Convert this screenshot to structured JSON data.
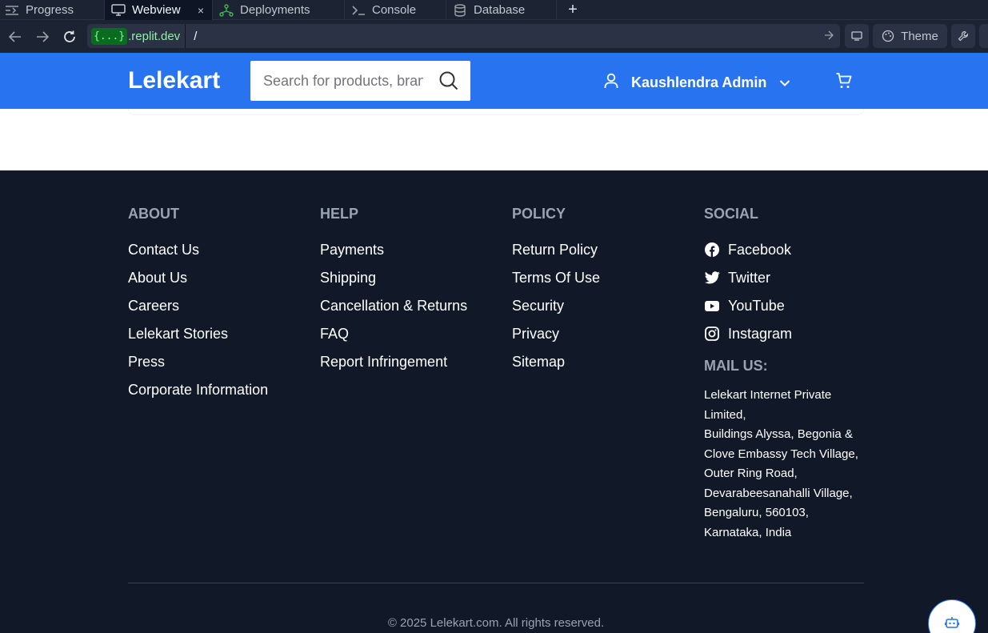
{
  "ide": {
    "tabs": [
      {
        "label": "Progress",
        "icon": "progress-icon"
      },
      {
        "label": "Webview",
        "icon": "monitor-icon",
        "active": true
      },
      {
        "label": "Deployments",
        "icon": "deployments-icon"
      },
      {
        "label": "Console",
        "icon": "terminal-icon"
      },
      {
        "label": "Database",
        "icon": "database-icon"
      }
    ],
    "new_tab_label": "+",
    "close_label": "×",
    "url_domain_badge": "{...}",
    "url_domain_rest": ".replit.dev",
    "url_path": "/",
    "theme_label": "Theme"
  },
  "header": {
    "logo": "Lelekart",
    "search_placeholder": "Search for products, brands and more",
    "user_name": "Kaushlendra Admin",
    "brand_color": "#2874f0"
  },
  "footer": {
    "about": {
      "heading": "ABOUT",
      "links": [
        "Contact Us",
        "About Us",
        "Careers",
        "Lelekart Stories",
        "Press",
        "Corporate Information"
      ]
    },
    "help": {
      "heading": "HELP",
      "links": [
        "Payments",
        "Shipping",
        "Cancellation & Returns",
        "FAQ",
        "Report Infringement"
      ]
    },
    "policy": {
      "heading": "POLICY",
      "links": [
        "Return Policy",
        "Terms Of Use",
        "Security",
        "Privacy",
        "Sitemap"
      ]
    },
    "social": {
      "heading": "SOCIAL",
      "links": [
        {
          "label": "Facebook",
          "icon": "facebook-icon"
        },
        {
          "label": "Twitter",
          "icon": "twitter-icon"
        },
        {
          "label": "YouTube",
          "icon": "youtube-icon"
        },
        {
          "label": "Instagram",
          "icon": "instagram-icon"
        }
      ]
    },
    "mail": {
      "heading": "MAIL US:",
      "lines": [
        "Lelekart Internet Private Limited,",
        "Buildings Alyssa, Begonia & Clove Embassy Tech Village,",
        "Outer Ring Road, Devarabeesanahalli Village,",
        "Bengaluru, 560103,",
        "Karnataka, India"
      ]
    },
    "copyright": "© 2025 Lelekart.com. All rights reserved.",
    "background_color": "#111827"
  }
}
